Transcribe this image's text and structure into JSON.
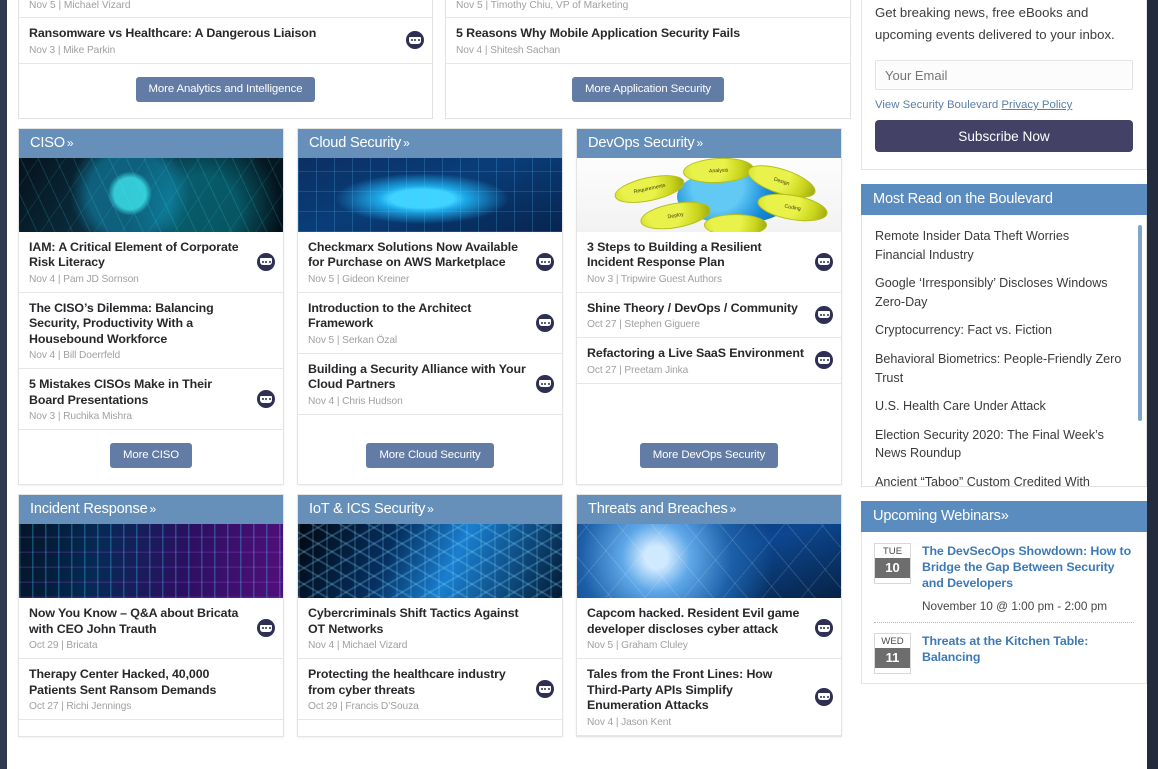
{
  "colors": {
    "card_header_blue": "#6690ba",
    "widget_header_blue": "#5b8cbf",
    "more_button_blue": "#627ca5",
    "subscribe_navy": "#434166",
    "webinar_link_blue": "#3d7ab5",
    "page_gutter_navy": "#2f3a51"
  },
  "top_row": {
    "analytics_card": {
      "partial_article_meta": "Nov 5 | Michael Vizard",
      "articles": [
        {
          "title": "Ransomware vs Healthcare: A Dangerous Liaison",
          "meta": "Nov 3 | Mike Parkin",
          "has_comments": true
        }
      ],
      "more_label": "More Analytics and Intelligence"
    },
    "appsec_card": {
      "partial_article_meta": "Nov 5 | Timothy Chiu, VP of Marketing",
      "articles": [
        {
          "title": "5 Reasons Why Mobile Application Security Fails",
          "meta": "Nov 4 | Shitesh Sachan",
          "has_comments": false
        }
      ],
      "more_label": "More Application Security"
    }
  },
  "categories": [
    {
      "id": "ciso",
      "title": "CISO",
      "chevron": "»",
      "thumb_class": "th-ciso",
      "thumb_name": "ciso-thumbnail-image",
      "articles": [
        {
          "title": "IAM: A Critical Element of Corporate Risk Literacy",
          "meta": "Nov 4 | Pam JD Sornson",
          "has_comments": true
        },
        {
          "title": "The CISO’s Dilemma: Balancing Security, Productivity With a Housebound Workforce",
          "meta": "Nov 4 | Bill Doerrfeld",
          "has_comments": false
        },
        {
          "title": "5 Mistakes CISOs Make in Their Board Presentations",
          "meta": "Nov 3 | Ruchika Mishra",
          "has_comments": true
        }
      ],
      "more_label": "More CISO"
    },
    {
      "id": "cloud-security",
      "title": "Cloud Security",
      "chevron": "»",
      "thumb_class": "th-cloud",
      "thumb_name": "cloud-security-thumbnail-image",
      "articles": [
        {
          "title": "Checkmarx Solutions Now Available for Purchase on AWS Marketplace",
          "meta": "Nov 5 | Gideon Kreiner",
          "has_comments": true
        },
        {
          "title": "Introduction to the Architect Framework",
          "meta": "Nov 5 | Serkan Özal",
          "has_comments": true
        },
        {
          "title": "Building a Security Alliance with Your Cloud Partners",
          "meta": "Nov 4 | Chris Hudson",
          "has_comments": true
        }
      ],
      "more_label": "More Cloud Security"
    },
    {
      "id": "devops-security",
      "title": "DevOps Security",
      "chevron": "»",
      "thumb_class": "th-devops",
      "thumb_name": "devops-security-thumbnail-image",
      "articles": [
        {
          "title": "3 Steps to Building a Resilient Incident Response Plan",
          "meta": "Nov 3 | Tripwire Guest Authors",
          "has_comments": true
        },
        {
          "title": "Shine Theory / DevOps / Community",
          "meta": "Oct 27 | Stephen Giguere",
          "has_comments": true
        },
        {
          "title": "Refactoring a Live SaaS Environment",
          "meta": "Oct 27 | Preetam Jinka",
          "has_comments": true
        }
      ],
      "more_label": "More DevOps Security"
    },
    {
      "id": "incident-response",
      "title": "Incident Response",
      "chevron": "»",
      "thumb_class": "th-incident",
      "thumb_name": "incident-response-thumbnail-image",
      "articles": [
        {
          "title": "Now You Know – Q&A about Bricata with CEO John Trauth",
          "meta": "Oct 29 | Bricata",
          "has_comments": true
        },
        {
          "title": "Therapy Center Hacked, 40,000 Patients Sent Ransom Demands",
          "meta": "Oct 27 | Richi Jennings",
          "has_comments": false
        }
      ],
      "more_label": ""
    },
    {
      "id": "iot-ics-security",
      "title": "IoT & ICS Security",
      "chevron": "»",
      "thumb_class": "th-iot",
      "thumb_name": "iot-ics-security-thumbnail-image",
      "articles": [
        {
          "title": "Cybercriminals Shift Tactics Against OT Networks",
          "meta": "Nov 4 | Michael Vizard",
          "has_comments": false
        },
        {
          "title": "Protecting the healthcare industry from cyber threats",
          "meta": "Oct 29 | Francis D’Souza",
          "has_comments": true
        }
      ],
      "more_label": ""
    },
    {
      "id": "threats-and-breaches",
      "title": "Threats and Breaches",
      "chevron": "»",
      "thumb_class": "th-threats",
      "thumb_name": "threats-and-breaches-thumbnail-image",
      "articles": [
        {
          "title": "Capcom hacked. Resident Evil game developer discloses cyber attack",
          "meta": "Nov 5 | Graham Cluley",
          "has_comments": true
        },
        {
          "title": "Tales from the Front Lines: How Third-Party APIs Simplify Enumeration Attacks",
          "meta": "Nov 4 | Jason Kent",
          "has_comments": true
        }
      ],
      "more_label": ""
    }
  ],
  "sidebar": {
    "newsletter": {
      "body": "Get breaking news, free eBooks and upcoming events delivered to your inbox.",
      "email_placeholder": "Your Email",
      "policy_prefix": "View Security Boulevard ",
      "policy_link": "Privacy Policy",
      "subscribe_label": "Subscribe Now"
    },
    "most_read": {
      "title": "Most Read on the Boulevard",
      "items": [
        "Remote Insider Data Theft Worries Financial Industry",
        "Google ‘Irresponsibly’ Discloses Windows Zero-Day",
        "Cryptocurrency: Fact vs. Fiction",
        "Behavioral Biometrics: People-Friendly Zero Trust",
        "U.S. Health Care Under Attack",
        "Election Security 2020: The Final Week’s News Roundup",
        "Ancient “Taboo” Custom Credited With"
      ]
    },
    "webinars": {
      "title": "Upcoming Webinars",
      "chevron": "»",
      "items": [
        {
          "dow": "TUE",
          "day": "10",
          "title": "The DevSecOps Showdown: How to Bridge the Gap Between Security and Developers",
          "when": "November 10 @ 1:00 pm - 2:00 pm"
        },
        {
          "dow": "WED",
          "day": "11",
          "title": "Threats at the Kitchen Table: Balancing",
          "when": ""
        }
      ]
    }
  }
}
